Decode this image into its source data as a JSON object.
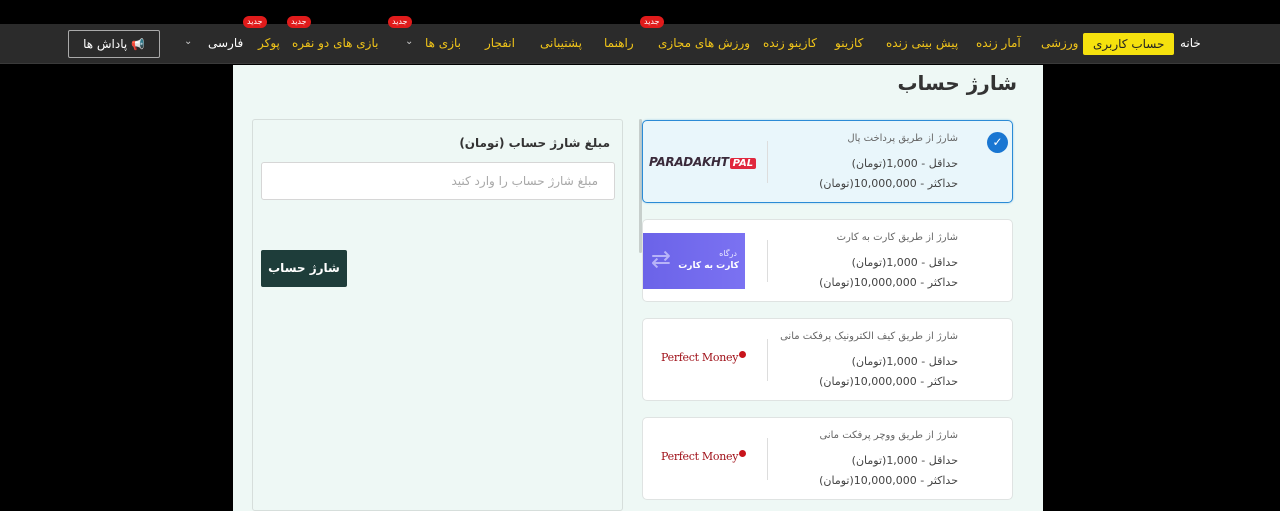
{
  "nav": {
    "home": "خانه",
    "account": "حساب کاربری",
    "sports": "ورزشی",
    "live_stats": "آمار زنده",
    "live_prediction": "پیش بینی زنده",
    "casino": "کازینو",
    "live_casino": "کازینو زنده",
    "virtual_sports": "ورزش های مجازی",
    "guide": "راهنما",
    "support": "پشتیبانی",
    "crash": "انفجار",
    "games": "بازی ها",
    "two_player": "بازی های دو نفره",
    "poker": "پوکر",
    "language": "فارسی",
    "rewards": "پاداش ها",
    "new_badge": "جدید"
  },
  "page": {
    "title": "شارژ حساب"
  },
  "form": {
    "amount_label": "مبلغ شارژ حساب (تومان)",
    "amount_placeholder": "مبلغ شارژ حساب را وارد کنید",
    "amount_value": "",
    "submit_label": "شارژ حساب"
  },
  "methods": [
    {
      "title": "شارژ از طریق پرداخت پال",
      "min": "حداقل - 1,000(تومان)",
      "max": "حداکثر - 10,000,000(تومان)",
      "logo_text_1": "PARADAKHT",
      "logo_text_2": "PAL",
      "selected": true
    },
    {
      "title": "شارژ از طریق کارت به کارت",
      "min": "حداقل - 1,000(تومان)",
      "max": "حداکثر - 10,000,000(تومان)",
      "logo_text_1": "درگاه",
      "logo_text_2": "کارت به کارت",
      "selected": false
    },
    {
      "title": "شارژ از طریق کیف الکترونیک پرفکت مانی",
      "min": "حداقل - 1,000(تومان)",
      "max": "حداکثر - 10,000,000(تومان)",
      "logo_text_1": "Perfect Money",
      "selected": false
    },
    {
      "title": "شارژ از طریق ووچر پرفکت مانی",
      "min": "حداقل - 1,000(تومان)",
      "max": "حداکثر - 10,000,000(تومان)",
      "logo_text_1": "Perfect Money",
      "selected": false
    }
  ],
  "colors": {
    "accent": "#f0c419",
    "active_tab": "#f5e10e",
    "badge": "#e01b1b",
    "submit_button": "#1e3d3a",
    "selected_border": "#2b8bd6"
  }
}
